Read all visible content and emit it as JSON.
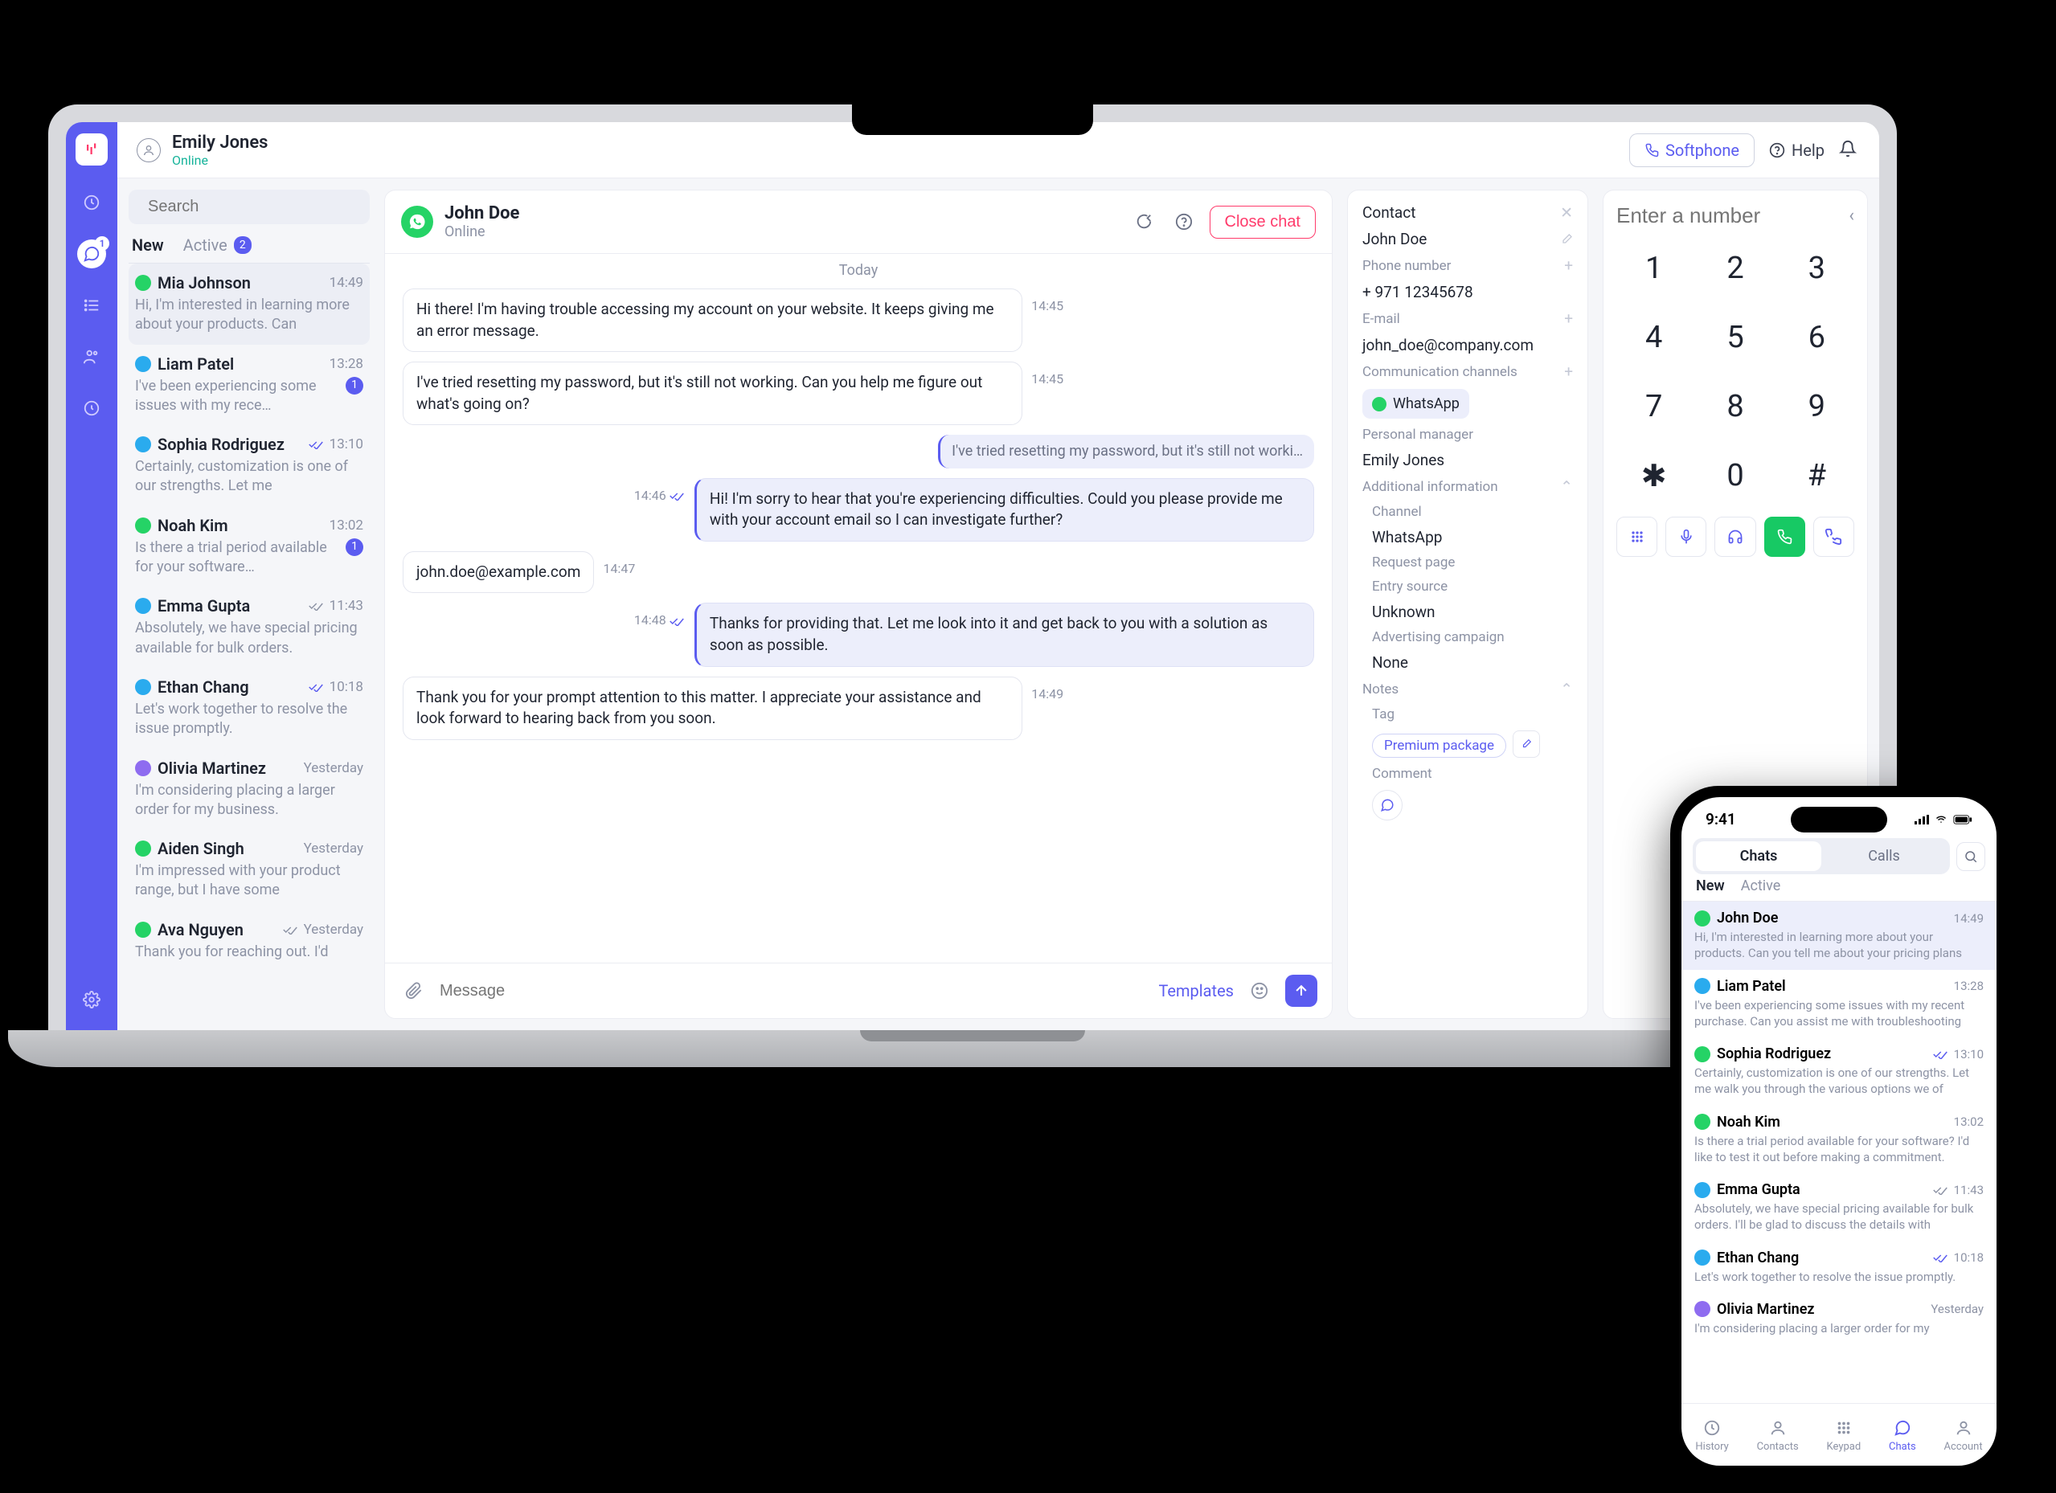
{
  "topbar": {
    "user_name": "Emily Jones",
    "user_status": "Online",
    "softphone_label": "Softphone",
    "help_label": "Help"
  },
  "navrail": {
    "chat_badge": "1"
  },
  "search": {
    "placeholder": "Search"
  },
  "list_tabs": {
    "new_label": "New",
    "active_label": "Active",
    "active_count": "2"
  },
  "chats": [
    {
      "name": "Mia Johnson",
      "time": "14:49",
      "channel": "wa",
      "preview": "Hi, I'm interested in learning more about your products. Can",
      "selected": true
    },
    {
      "name": "Liam Patel",
      "time": "13:28",
      "channel": "tg",
      "preview": "I've been experiencing some issues with my rece…",
      "unread": "1"
    },
    {
      "name": "Sophia Rodriguez",
      "time": "13:10",
      "channel": "tg",
      "preview": "Certainly, customization is one of our strengths. Let me",
      "read": true
    },
    {
      "name": "Noah Kim",
      "time": "13:02",
      "channel": "wa",
      "preview": "Is there a trial period available for your software…",
      "unread": "1"
    },
    {
      "name": "Emma Gupta",
      "time": "11:43",
      "channel": "tg",
      "preview": "Absolutely, we have special pricing available for bulk orders.",
      "check": true
    },
    {
      "name": "Ethan Chang",
      "time": "10:18",
      "channel": "tg",
      "preview": "Let's work together to resolve the issue promptly.",
      "read": true
    },
    {
      "name": "Olivia Martinez",
      "time": "Yesterday",
      "channel": "pu",
      "preview": "I'm considering placing a larger order for my business."
    },
    {
      "name": "Aiden Singh",
      "time": "Yesterday",
      "channel": "wa",
      "preview": "I'm impressed with your product range, but I have some"
    },
    {
      "name": "Ava Nguyen",
      "time": "Yesterday",
      "channel": "wa",
      "preview": "Thank you for reaching out. I'd",
      "check": true
    }
  ],
  "conversation": {
    "name": "John Doe",
    "status": "Online",
    "close_label": "Close chat",
    "day_label": "Today",
    "messages": [
      {
        "dir": "in",
        "text": "Hi there! I'm having trouble accessing my account on your website. It keeps giving me an error message.",
        "time": "14:45"
      },
      {
        "dir": "in",
        "text": "I've tried resetting my password, but it's still not working. Can you help me figure out what's going on?",
        "time": "14:45"
      },
      {
        "dir": "quote",
        "text": "I've tried resetting my password, but it's still not worki…"
      },
      {
        "dir": "out",
        "text": "Hi! I'm sorry to hear that you're experiencing difficulties. Could you please provide me with your account email so I can investigate further?",
        "time": "14:46",
        "read": true
      },
      {
        "dir": "in",
        "text": "john.doe@example.com",
        "time": "14:47"
      },
      {
        "dir": "out",
        "text": "Thanks for providing that. Let me look into it and get back to you with a solution as soon as possible.",
        "time": "14:48",
        "read": true
      },
      {
        "dir": "in",
        "text": "Thank you for your prompt attention to this matter. I appreciate your assistance and look forward to hearing back from you soon.",
        "time": "14:49"
      }
    ],
    "composer": {
      "placeholder": "Message",
      "templates_label": "Templates"
    }
  },
  "contact": {
    "title": "Contact",
    "name": "John Doe",
    "phone_label": "Phone number",
    "phone": "+ 971 12345678",
    "email_label": "E-mail",
    "email": "john_doe@company.com",
    "channels_label": "Communication channels",
    "channel_wa": "WhatsApp",
    "manager_label": "Personal manager",
    "manager": "Emily Jones",
    "additional_label": "Additional information",
    "channel_label2": "Channel",
    "channel_value": "WhatsApp",
    "request_label": "Request page",
    "entry_label": "Entry source",
    "entry_value": "Unknown",
    "campaign_label": "Advertising campaign",
    "campaign_value": "None",
    "notes_label": "Notes",
    "tag_label": "Tag",
    "tag_value": "Premium package",
    "comment_label": "Comment"
  },
  "dialer": {
    "placeholder": "Enter a number",
    "keys": [
      "1",
      "2",
      "3",
      "4",
      "5",
      "6",
      "7",
      "8",
      "9",
      "✱",
      "0",
      "#"
    ]
  },
  "phone": {
    "time": "9:41",
    "seg_chats": "Chats",
    "seg_calls": "Calls",
    "tab_new": "New",
    "tab_active": "Active",
    "items": [
      {
        "name": "John Doe",
        "time": "14:49",
        "channel": "wa",
        "preview": "Hi, I'm interested in learning more about your products. Can you tell me about your pricing plans",
        "selected": true
      },
      {
        "name": "Liam Patel",
        "time": "13:28",
        "channel": "tg",
        "preview": "I've been experiencing some issues with my recent purchase. Can you assist me with troubleshooting"
      },
      {
        "name": "Sophia Rodriguez",
        "time": "13:10",
        "channel": "wa",
        "preview": "Certainly, customization is one of our strengths. Let me walk you through the various options we of",
        "read": true
      },
      {
        "name": "Noah Kim",
        "time": "13:02",
        "channel": "wa",
        "preview": "Is there a trial period available for your software? I'd like to test it out before making a commitment."
      },
      {
        "name": "Emma Gupta",
        "time": "11:43",
        "channel": "tg",
        "preview": "Absolutely, we have special pricing available for bulk orders. I'll be glad to discuss the details with",
        "check": true
      },
      {
        "name": "Ethan Chang",
        "time": "10:18",
        "channel": "tg",
        "preview": "Let's work together to resolve the issue promptly.",
        "read": true
      },
      {
        "name": "Olivia Martinez",
        "time": "Yesterday",
        "channel": "pu",
        "preview": "I'm considering placing a larger order for my"
      }
    ],
    "nav": {
      "history": "History",
      "contacts": "Contacts",
      "keypad": "Keypad",
      "chats": "Chats",
      "account": "Account"
    }
  }
}
